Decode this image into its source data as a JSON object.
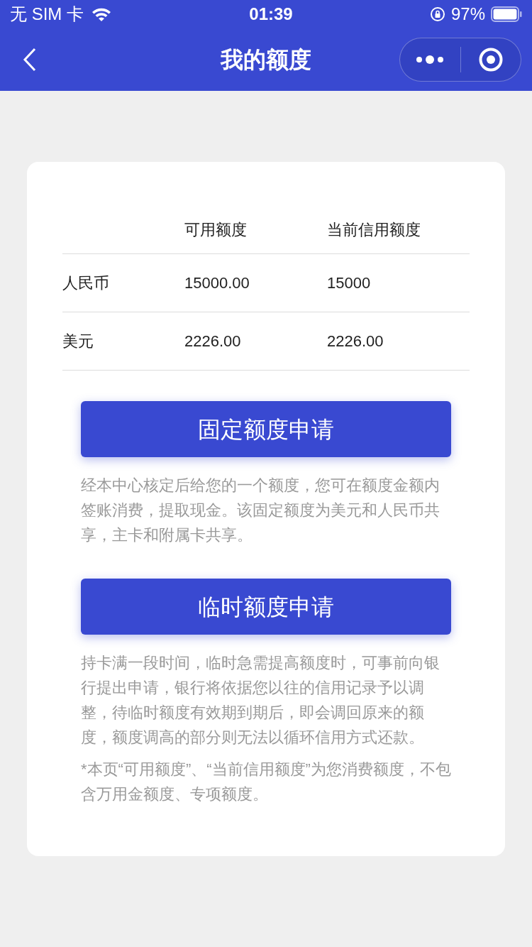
{
  "status_bar": {
    "carrier": "无 SIM 卡",
    "time": "01:39",
    "battery": "97%"
  },
  "nav": {
    "title": "我的额度"
  },
  "table": {
    "columns": [
      "可用额度",
      "当前信用额度"
    ],
    "rows": [
      {
        "currency": "人民币",
        "available": "15000.00",
        "credit": "15000"
      },
      {
        "currency": "美元",
        "available": "2226.00",
        "credit": "2226.00"
      }
    ]
  },
  "sections": [
    {
      "button": "固定额度申请",
      "description": "经本中心核定后给您的一个额度，您可在额度金额内签账消费，提取现金。该固定额度为美元和人民币共享，主卡和附属卡共享。"
    },
    {
      "button": "临时额度申请",
      "description": "持卡满一段时间，临时急需提高额度时，可事前向银行提出申请，银行将依据您以往的信用记录予以调整，待临时额度有效期到期后，即会调回原来的额度，额度调高的部分则无法以循环信用方式还款。"
    }
  ],
  "footnote": "*本页“可用额度”、“当前信用额度”为您消费额度，不包含万用金额度、专项额度。"
}
